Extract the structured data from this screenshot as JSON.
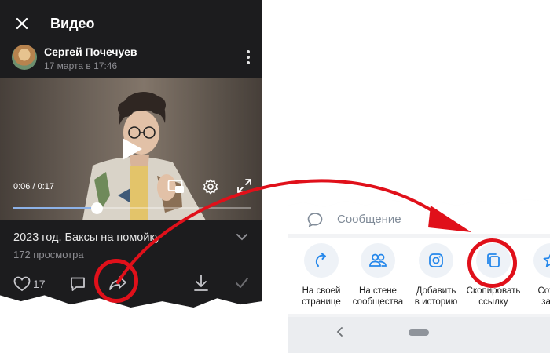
{
  "video_screen": {
    "title": "Видео",
    "author": "Сергей Почечуев",
    "date": "17 марта в 17:46",
    "player": {
      "time": "0:06 / 0:17",
      "progress_fraction": 0.35
    },
    "video_title": "2023 год. Баксы на помойку",
    "views": "172 просмотра",
    "likes": "17"
  },
  "share_screen": {
    "message_placeholder": "Сообщение",
    "items": [
      {
        "label": "На своей\nстранице",
        "icon": "repost-icon"
      },
      {
        "label": "На стене\nсообщества",
        "icon": "community-icon"
      },
      {
        "label": "Добавить\nв историю",
        "icon": "story-icon"
      },
      {
        "label": "Скопировать\nссылку",
        "icon": "copy-link-icon"
      },
      {
        "label": "Сохра\nзакл",
        "icon": "bookmark-icon"
      }
    ]
  },
  "colors": {
    "accent_blue": "#2688eb",
    "highlight_red": "#e0101a"
  }
}
